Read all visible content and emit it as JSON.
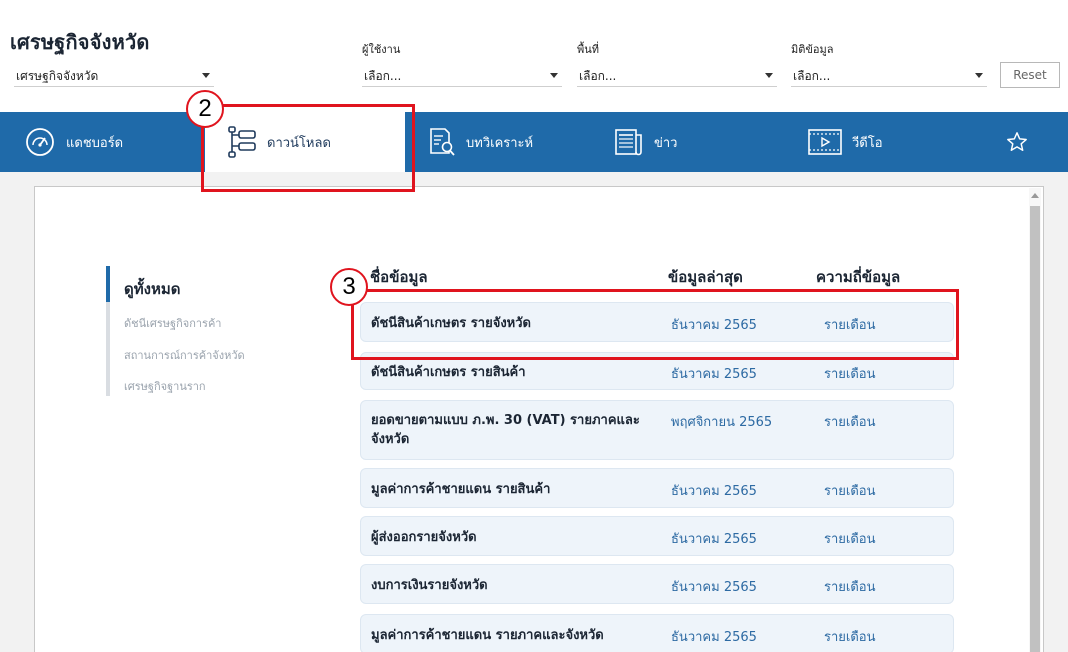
{
  "header": {
    "title": "เศรษฐกิจจังหวัด",
    "filters": [
      {
        "label": "",
        "value": "เศรษฐกิจจังหวัด"
      },
      {
        "label": "ผู้ใช้งาน",
        "value": "เลือก..."
      },
      {
        "label": "พื้นที่",
        "value": "เลือก..."
      },
      {
        "label": "มิติข้อมูล",
        "value": "เลือก..."
      }
    ],
    "reset_label": "Reset"
  },
  "nav": {
    "items": [
      {
        "label": "แดชบอร์ด",
        "icon": "dashboard-gauge-icon"
      },
      {
        "label": "ดาวน์โหลด",
        "icon": "download-tree-icon",
        "active": true
      },
      {
        "label": "บทวิเคราะห์",
        "icon": "analysis-document-icon"
      },
      {
        "label": "ข่าว",
        "icon": "news-icon"
      },
      {
        "label": "วีดีโอ",
        "icon": "video-icon"
      }
    ],
    "favorite_icon": "star-icon"
  },
  "sidebar": {
    "title": "ดูทั้งหมด",
    "links": [
      "ดัชนีเศรษฐกิจการค้า",
      "สถานการณ์การค้าจังหวัด",
      "เศรษฐกิจฐานราก"
    ]
  },
  "table": {
    "headers": {
      "name": "ชื่อข้อมูล",
      "latest": "ข้อมูลล่าสุด",
      "frequency": "ความถี่ข้อมูล"
    },
    "rows": [
      {
        "name": "ดัชนีสินค้าเกษตร รายจังหวัด",
        "latest": "ธันวาคม 2565",
        "frequency": "รายเดือน"
      },
      {
        "name": "ดัชนีสินค้าเกษตร รายสินค้า",
        "latest": "ธันวาคม 2565",
        "frequency": "รายเดือน"
      },
      {
        "name": "ยอดขายตามแบบ ภ.พ. 30 (VAT) รายภาคและจังหวัด",
        "latest": "พฤศจิกายน 2565",
        "frequency": "รายเดือน"
      },
      {
        "name": "มูลค่าการค้าชายแดน รายสินค้า",
        "latest": "ธันวาคม 2565",
        "frequency": "รายเดือน"
      },
      {
        "name": "ผู้ส่งออกรายจังหวัด",
        "latest": "ธันวาคม 2565",
        "frequency": "รายเดือน"
      },
      {
        "name": "งบการเงินรายจังหวัด",
        "latest": "ธันวาคม 2565",
        "frequency": "รายเดือน"
      },
      {
        "name": "มูลค่าการค้าชายแดน รายภาคและจังหวัด",
        "latest": "ธันวาคม 2565",
        "frequency": "รายเดือน"
      }
    ]
  },
  "annotations": {
    "step_2": "2",
    "step_3": "3",
    "highlight_color": "#e0141e"
  },
  "colors": {
    "nav_blue": "#1f6aa9",
    "row_bg": "#eef4fa",
    "link_blue": "#2d6aa3"
  }
}
